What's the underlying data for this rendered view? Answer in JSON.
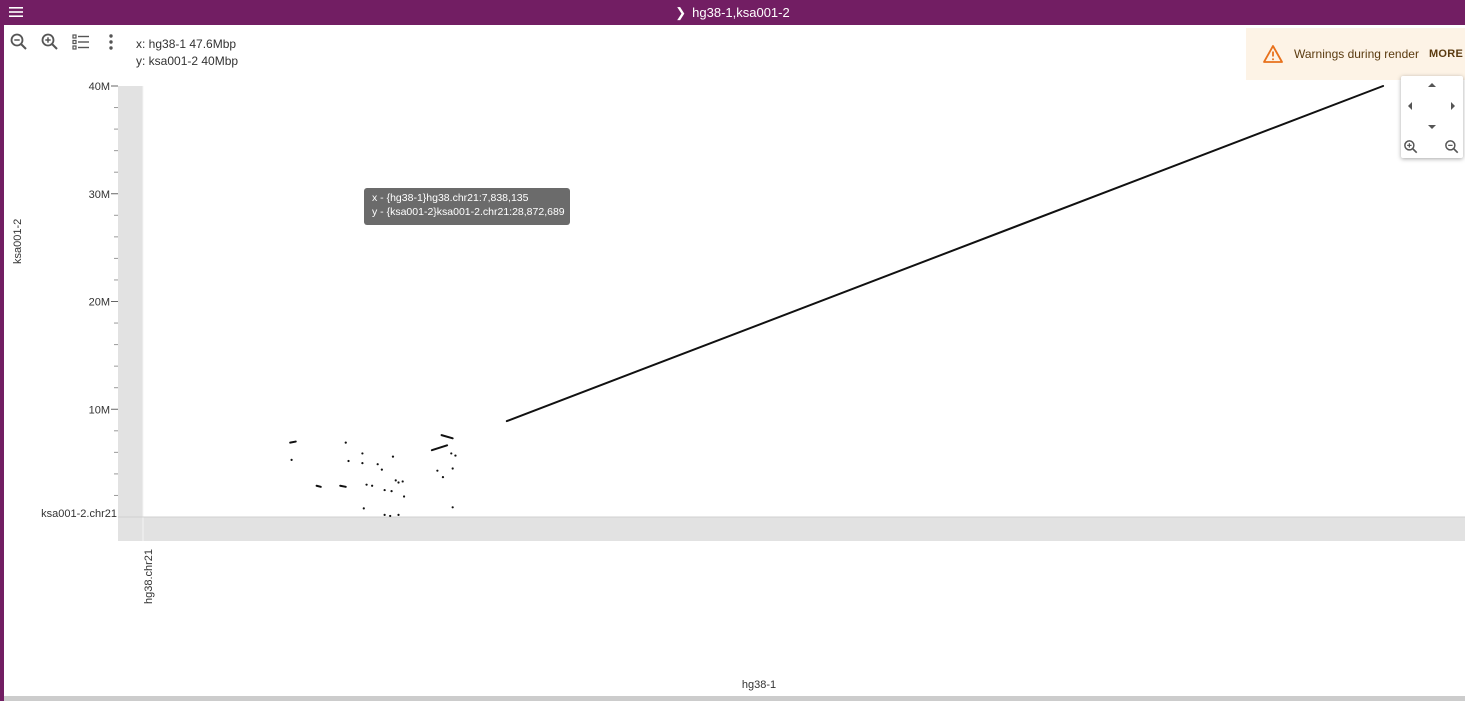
{
  "window": {
    "title": "hg38-1,ksa001-2"
  },
  "toolbar": {
    "zoom_out_icon": "zoom-out-icon",
    "zoom_in_icon": "zoom-in-icon",
    "tracks_icon": "list-icon",
    "more_icon": "more-vert-icon"
  },
  "readout": {
    "x": "x: hg38-1 47.6Mbp",
    "y": "y: ksa001-2 40Mbp"
  },
  "warning": {
    "icon": "warning-icon",
    "text": "Warnings during render",
    "more_label": "MORE",
    "color": "#e8711c"
  },
  "tooltip": {
    "line1": "x - {hg38-1}hg38.chr21:7,838,135",
    "line2": "y - {ksa001-2}ksa001-2.chr21:28,872,689"
  },
  "chart_data": {
    "type": "scatter",
    "xlabel": "hg38-1",
    "ylabel": "ksa001-2",
    "x_region_label": "hg38.chr21",
    "y_region_label": "ksa001-2.chr21",
    "y_ticks": [
      {
        "label": "10M",
        "value": 10000000
      },
      {
        "label": "20M",
        "value": 20000000
      },
      {
        "label": "30M",
        "value": 30000000
      },
      {
        "label": "40M",
        "value": 40000000
      }
    ],
    "ylim": [
      0,
      40000000
    ],
    "xlim": [
      0,
      47600000
    ],
    "line_segments": [
      {
        "x1": 13100000,
        "y1": 8900000,
        "x2": 44650000,
        "y2": 40000000
      },
      {
        "x1": 10400000,
        "y1": 6200000,
        "x2": 10950000,
        "y2": 6650000
      },
      {
        "x1": 10750000,
        "y1": 7600000,
        "x2": 11150000,
        "y2": 7300000
      },
      {
        "x1": 5300000,
        "y1": 6900000,
        "x2": 5500000,
        "y2": 7000000
      },
      {
        "x1": 6250000,
        "y1": 2900000,
        "x2": 6400000,
        "y2": 2800000
      },
      {
        "x1": 7100000,
        "y1": 2900000,
        "x2": 7300000,
        "y2": 2800000
      }
    ],
    "points": [
      [
        5350000,
        5300000
      ],
      [
        7300000,
        6900000
      ],
      [
        7400000,
        5200000
      ],
      [
        7900000,
        5900000
      ],
      [
        7900000,
        5000000
      ],
      [
        8450000,
        4900000
      ],
      [
        8600000,
        4400000
      ],
      [
        9000000,
        5600000
      ],
      [
        8050000,
        3000000
      ],
      [
        8250000,
        2900000
      ],
      [
        8700000,
        2500000
      ],
      [
        8950000,
        2400000
      ],
      [
        9200000,
        3200000
      ],
      [
        9400000,
        1900000
      ],
      [
        9100000,
        3400000
      ],
      [
        9350000,
        3300000
      ],
      [
        7950000,
        800000
      ],
      [
        8700000,
        200000
      ],
      [
        8900000,
        100000
      ],
      [
        9200000,
        200000
      ],
      [
        10600000,
        4300000
      ],
      [
        10800000,
        3700000
      ],
      [
        11150000,
        4500000
      ],
      [
        11250000,
        5700000
      ],
      [
        11100000,
        5900000
      ],
      [
        11150000,
        900000
      ]
    ]
  }
}
